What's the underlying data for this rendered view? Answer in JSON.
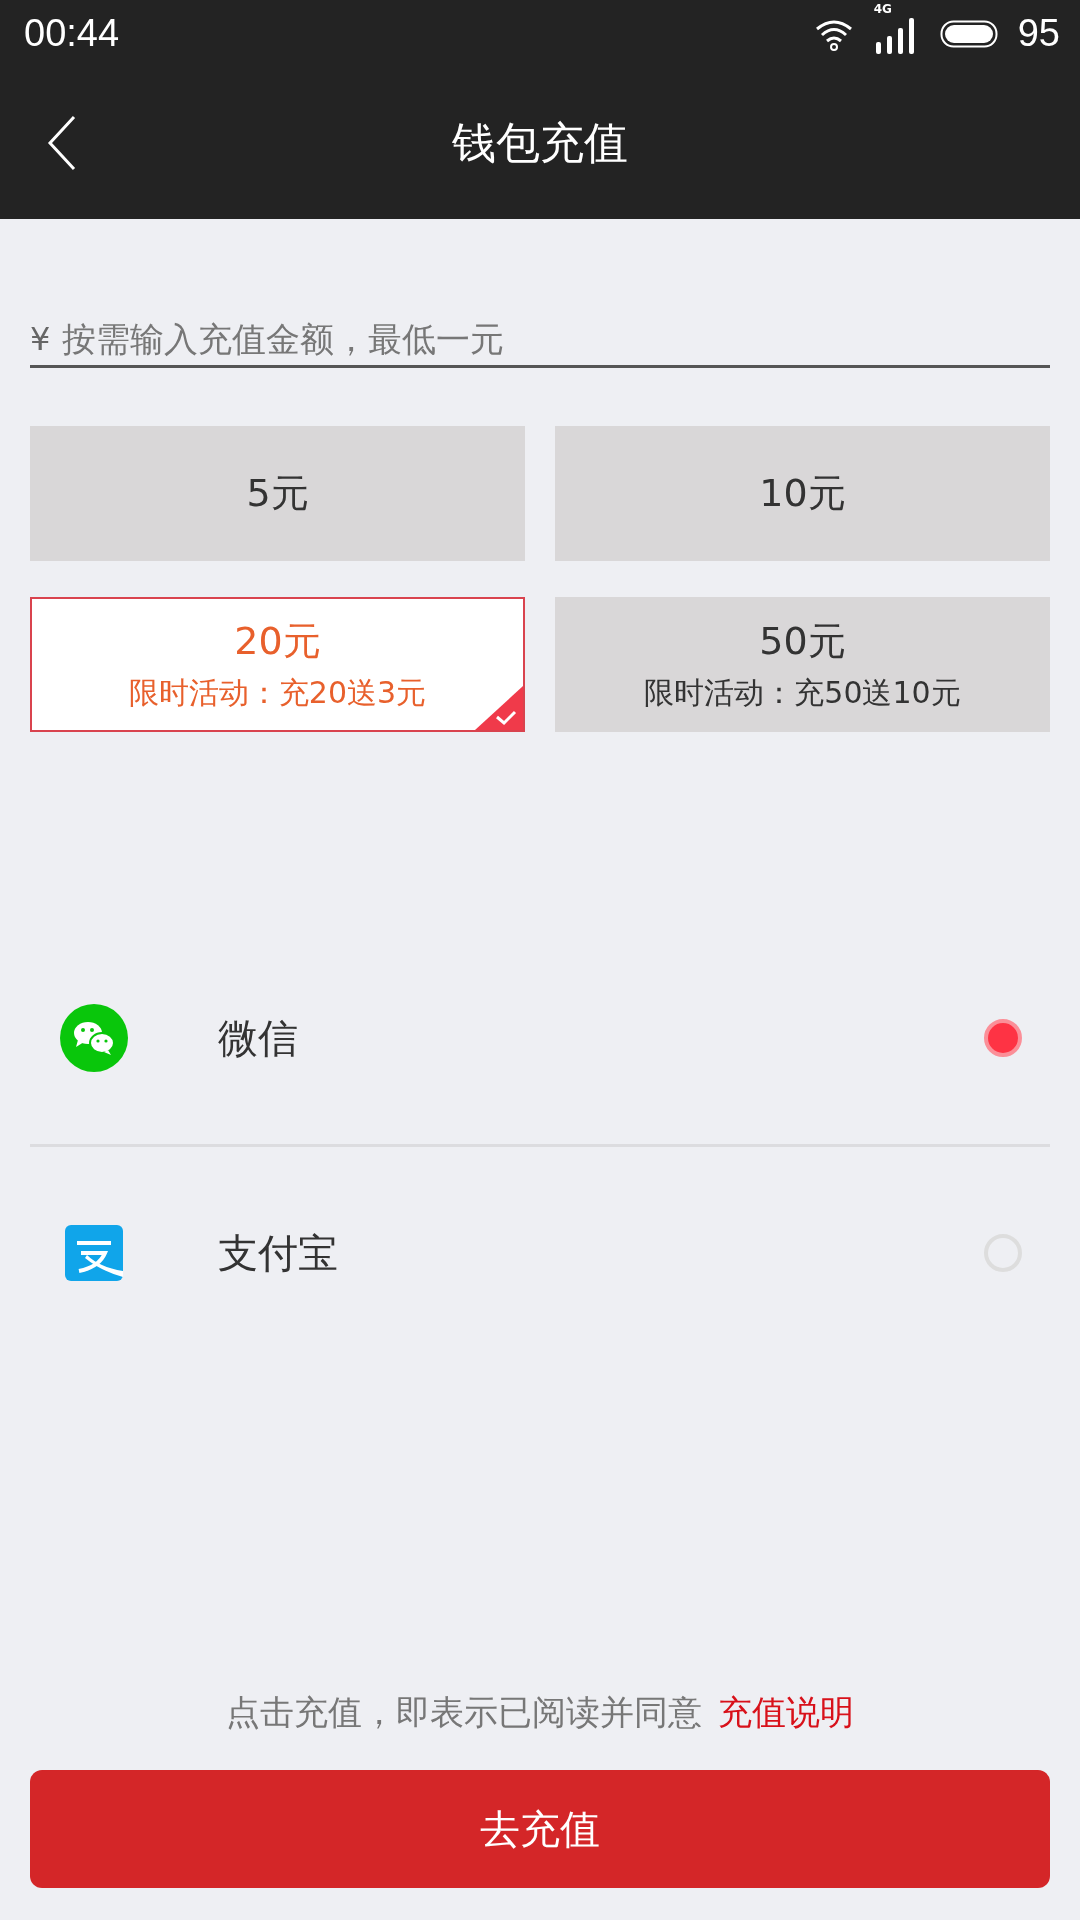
{
  "status_bar": {
    "time": "00:44",
    "network": "4G",
    "battery": "95"
  },
  "header": {
    "title": "钱包充值"
  },
  "amount_input": {
    "currency": "¥",
    "placeholder": "按需输入充值金额，最低一元"
  },
  "options": [
    {
      "amount": "5元",
      "selected": false
    },
    {
      "amount": "10元",
      "selected": false
    },
    {
      "amount": "20元",
      "promo": "限时活动：充20送3元",
      "selected": true
    },
    {
      "amount": "50元",
      "promo": "限时活动：充50送10元",
      "selected": false
    }
  ],
  "payment_methods": [
    {
      "kind": "wechat",
      "label": "微信",
      "selected": true
    },
    {
      "kind": "alipay",
      "label": "支付宝",
      "selected": false
    }
  ],
  "agreement": {
    "text": "点击充值，即表示已阅读并同意",
    "link": "充值说明"
  },
  "submit_button": {
    "label": "去充值"
  }
}
